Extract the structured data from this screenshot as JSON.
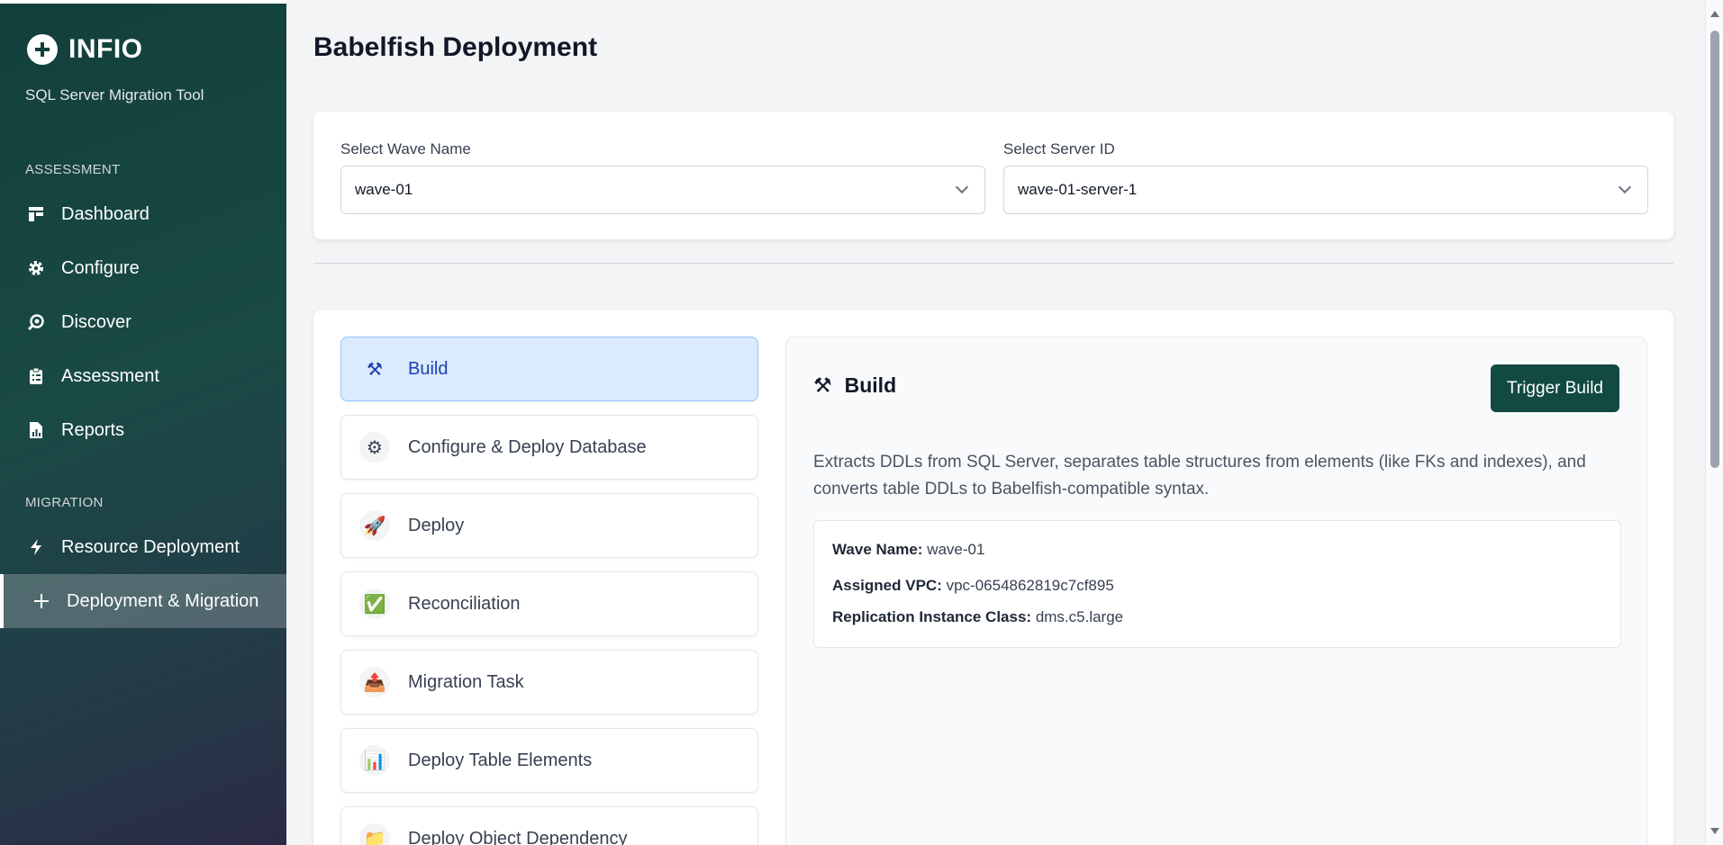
{
  "sidebar": {
    "brand": "INFIO",
    "subtitle": "SQL Server Migration Tool",
    "sections": [
      {
        "label": "ASSESSMENT",
        "items": [
          {
            "label": "Dashboard",
            "icon": "dashboard-icon"
          },
          {
            "label": "Configure",
            "icon": "gear-icon"
          },
          {
            "label": "Discover",
            "icon": "search-icon"
          },
          {
            "label": "Assessment",
            "icon": "clipboard-icon"
          },
          {
            "label": "Reports",
            "icon": "report-icon"
          }
        ]
      },
      {
        "label": "MIGRATION",
        "items": [
          {
            "label": "Resource Deployment",
            "icon": "bolt-icon"
          },
          {
            "label": "Deployment & Migration",
            "icon": "plus-icon",
            "active": true
          }
        ]
      }
    ]
  },
  "page": {
    "title": "Babelfish Deployment",
    "wave_select": {
      "label": "Select Wave Name",
      "value": "wave-01"
    },
    "server_select": {
      "label": "Select Server ID",
      "value": "wave-01-server-1"
    }
  },
  "steps": [
    {
      "label": "Build",
      "icon": "hammer-wrench-icon",
      "glyph": "⚒",
      "active": true
    },
    {
      "label": "Configure & Deploy Database",
      "icon": "gear-icon",
      "glyph": "⚙"
    },
    {
      "label": "Deploy",
      "icon": "rocket-icon",
      "glyph": "🚀"
    },
    {
      "label": "Reconciliation",
      "icon": "check-box-icon",
      "glyph": "✅"
    },
    {
      "label": "Migration Task",
      "icon": "upload-tray-icon",
      "glyph": "📤"
    },
    {
      "label": "Deploy Table Elements",
      "icon": "bar-chart-icon",
      "glyph": "📊"
    },
    {
      "label": "Deploy Object Dependency",
      "icon": "folder-icon",
      "glyph": "📁"
    }
  ],
  "detail": {
    "title": "Build",
    "icon": "hammer-wrench-icon",
    "glyph": "⚒",
    "button": "Trigger Build",
    "description": "Extracts DDLs from SQL Server, separates table structures from elements (like FKs and indexes), and converts table DDLs to Babelfish-compatible syntax.",
    "info": {
      "wave_label": "Wave Name:",
      "wave_value": "wave-01",
      "vpc_label": "Assigned VPC:",
      "vpc_value": "vpc-0654862819c7cf895",
      "class_label": "Replication Instance Class:",
      "class_value": "dms.c5.large"
    }
  },
  "colors": {
    "primary": "#124a42",
    "active_step_bg": "#dbeafe",
    "active_step_text": "#1e40af"
  }
}
